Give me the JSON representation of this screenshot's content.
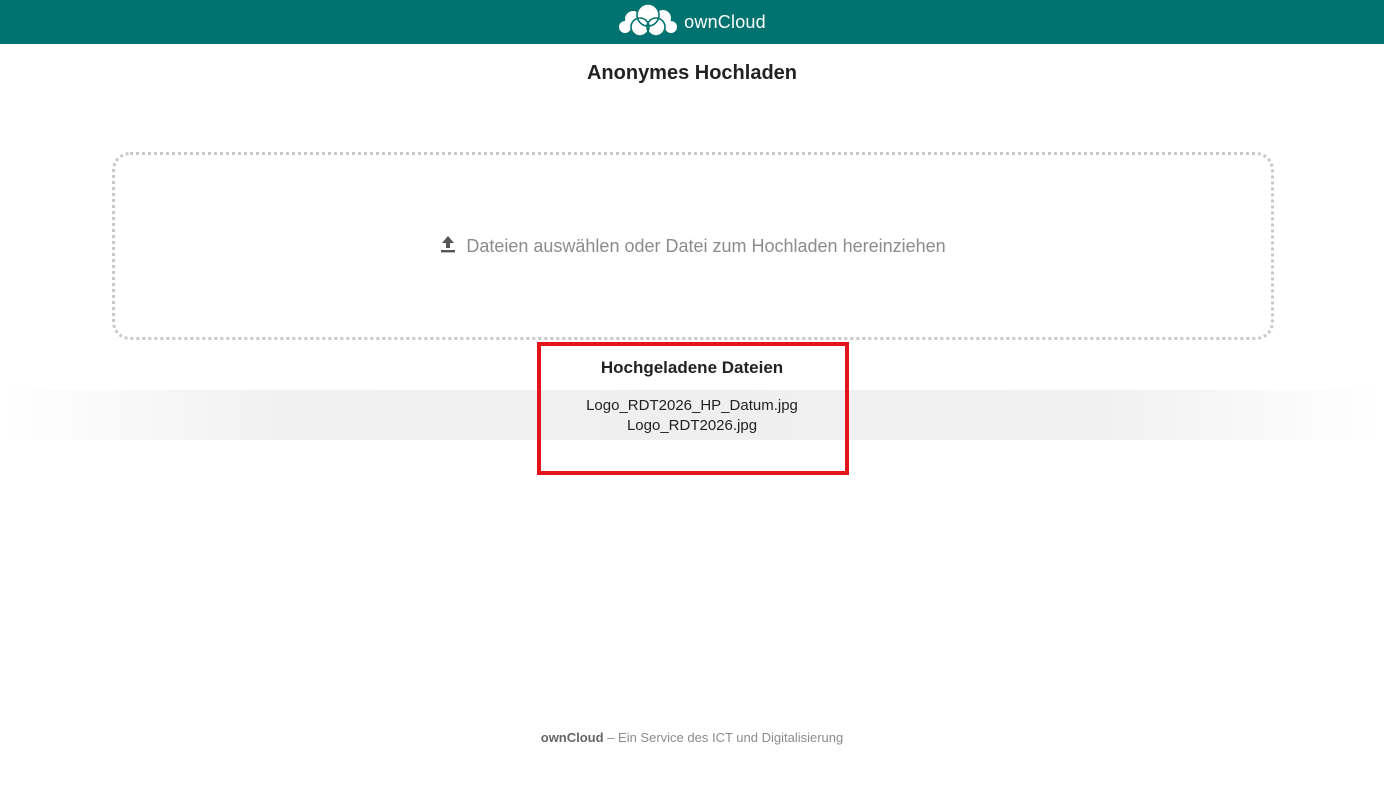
{
  "header": {
    "brand_name": "ownCloud",
    "logo_icon": "cloud-icon",
    "background_color": "#00726f"
  },
  "page": {
    "title": "Anonymes Hochladen"
  },
  "dropzone": {
    "icon": "upload-icon",
    "label": "Dateien auswählen oder Datei zum Hochladen hereinziehen"
  },
  "uploaded": {
    "title": "Hochgeladene Dateien",
    "files": [
      "Logo_RDT2026_HP_Datum.jpg",
      "Logo_RDT2026.jpg"
    ]
  },
  "highlight_color": "#e6131b",
  "footer": {
    "brand": "ownCloud",
    "text": " – Ein Service des ICT und Digitalisierung"
  }
}
